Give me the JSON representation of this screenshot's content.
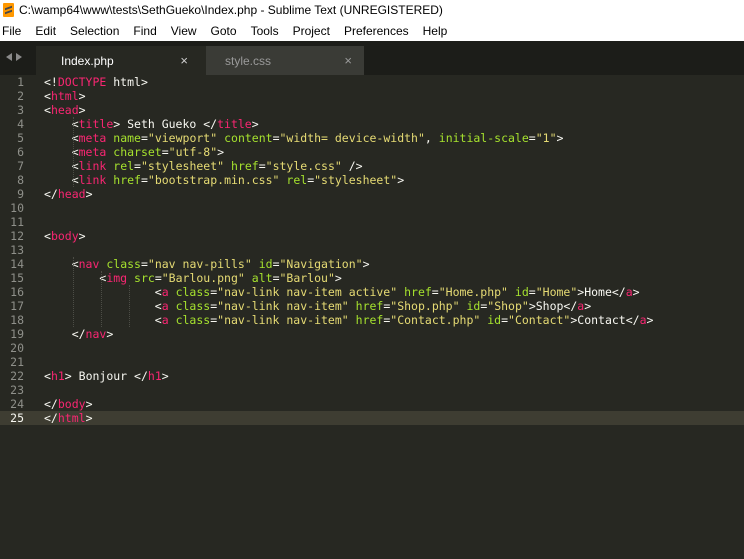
{
  "window": {
    "title": "C:\\wamp64\\www\\tests\\SethGueko\\Index.php - Sublime Text (UNREGISTERED)"
  },
  "menu": [
    "File",
    "Edit",
    "Selection",
    "Find",
    "View",
    "Goto",
    "Tools",
    "Project",
    "Preferences",
    "Help"
  ],
  "tabs": [
    {
      "label": "Index.php",
      "active": true,
      "close": "×"
    },
    {
      "label": "style.css",
      "active": false,
      "close": "×"
    }
  ],
  "current_line": 25,
  "colors": {
    "background": "#272822",
    "tag": "#f92672",
    "attribute": "#a6e22e",
    "string": "#e6db74",
    "text": "#f8f8f2",
    "line_number": "#8f908a"
  },
  "code_lines": [
    [
      [
        "p",
        "<!"
      ],
      [
        "t",
        "DOCTYPE"
      ],
      [
        "p",
        " html>"
      ]
    ],
    [
      [
        "p",
        "<"
      ],
      [
        "t",
        "html"
      ],
      [
        "p",
        ">"
      ]
    ],
    [
      [
        "p",
        "<"
      ],
      [
        "t",
        "head"
      ],
      [
        "p",
        ">"
      ]
    ],
    [
      [
        "p",
        "    <"
      ],
      [
        "t",
        "title"
      ],
      [
        "p",
        "> Seth Gueko </"
      ],
      [
        "t",
        "title"
      ],
      [
        "p",
        ">"
      ]
    ],
    [
      [
        "p",
        "    <"
      ],
      [
        "t",
        "meta"
      ],
      [
        "p",
        " "
      ],
      [
        "a",
        "name"
      ],
      [
        "p",
        "="
      ],
      [
        "s",
        "\"viewport\""
      ],
      [
        "p",
        " "
      ],
      [
        "a",
        "content"
      ],
      [
        "p",
        "="
      ],
      [
        "s",
        "\"width= device-width\""
      ],
      [
        "p",
        ", "
      ],
      [
        "a",
        "initial-scale"
      ],
      [
        "p",
        "="
      ],
      [
        "s",
        "\"1\""
      ],
      [
        "p",
        ">"
      ]
    ],
    [
      [
        "p",
        "    <"
      ],
      [
        "t",
        "meta"
      ],
      [
        "p",
        " "
      ],
      [
        "a",
        "charset"
      ],
      [
        "p",
        "="
      ],
      [
        "s",
        "\"utf-8\""
      ],
      [
        "p",
        ">"
      ]
    ],
    [
      [
        "p",
        "    <"
      ],
      [
        "t",
        "link"
      ],
      [
        "p",
        " "
      ],
      [
        "a",
        "rel"
      ],
      [
        "p",
        "="
      ],
      [
        "s",
        "\"stylesheet\""
      ],
      [
        "p",
        " "
      ],
      [
        "a",
        "href"
      ],
      [
        "p",
        "="
      ],
      [
        "s",
        "\"style.css\""
      ],
      [
        "p",
        " />"
      ]
    ],
    [
      [
        "p",
        "    <"
      ],
      [
        "t",
        "link"
      ],
      [
        "p",
        " "
      ],
      [
        "a",
        "href"
      ],
      [
        "p",
        "="
      ],
      [
        "s",
        "\"bootstrap.min.css\""
      ],
      [
        "p",
        " "
      ],
      [
        "a",
        "rel"
      ],
      [
        "p",
        "="
      ],
      [
        "s",
        "\"stylesheet\""
      ],
      [
        "p",
        ">"
      ]
    ],
    [
      [
        "p",
        "</"
      ],
      [
        "t",
        "head"
      ],
      [
        "p",
        ">"
      ]
    ],
    [],
    [],
    [
      [
        "p",
        "<"
      ],
      [
        "t",
        "body"
      ],
      [
        "p",
        ">"
      ]
    ],
    [],
    [
      [
        "p",
        "    <"
      ],
      [
        "t",
        "nav"
      ],
      [
        "p",
        " "
      ],
      [
        "a",
        "class"
      ],
      [
        "p",
        "="
      ],
      [
        "s",
        "\"nav nav-pills\""
      ],
      [
        "p",
        " "
      ],
      [
        "a",
        "id"
      ],
      [
        "p",
        "="
      ],
      [
        "s",
        "\"Navigation\""
      ],
      [
        "p",
        ">"
      ]
    ],
    [
      [
        "p",
        "        <"
      ],
      [
        "t",
        "img"
      ],
      [
        "p",
        " "
      ],
      [
        "a",
        "src"
      ],
      [
        "p",
        "="
      ],
      [
        "s",
        "\"Barlou.png\""
      ],
      [
        "p",
        " "
      ],
      [
        "a",
        "alt"
      ],
      [
        "p",
        "="
      ],
      [
        "s",
        "\"Barlou\""
      ],
      [
        "p",
        ">"
      ]
    ],
    [
      [
        "p",
        "                <"
      ],
      [
        "t",
        "a"
      ],
      [
        "p",
        " "
      ],
      [
        "a",
        "class"
      ],
      [
        "p",
        "="
      ],
      [
        "s",
        "\"nav-link nav-item active\""
      ],
      [
        "p",
        " "
      ],
      [
        "a",
        "href"
      ],
      [
        "p",
        "="
      ],
      [
        "s",
        "\"Home.php\""
      ],
      [
        "p",
        " "
      ],
      [
        "a",
        "id"
      ],
      [
        "p",
        "="
      ],
      [
        "s",
        "\"Home\""
      ],
      [
        "p",
        ">Home</"
      ],
      [
        "t",
        "a"
      ],
      [
        "p",
        ">"
      ]
    ],
    [
      [
        "p",
        "                <"
      ],
      [
        "t",
        "a"
      ],
      [
        "p",
        " "
      ],
      [
        "a",
        "class"
      ],
      [
        "p",
        "="
      ],
      [
        "s",
        "\"nav-link nav-item\""
      ],
      [
        "p",
        " "
      ],
      [
        "a",
        "href"
      ],
      [
        "p",
        "="
      ],
      [
        "s",
        "\"Shop.php\""
      ],
      [
        "p",
        " "
      ],
      [
        "a",
        "id"
      ],
      [
        "p",
        "="
      ],
      [
        "s",
        "\"Shop\""
      ],
      [
        "p",
        ">Shop</"
      ],
      [
        "t",
        "a"
      ],
      [
        "p",
        ">"
      ]
    ],
    [
      [
        "p",
        "                <"
      ],
      [
        "t",
        "a"
      ],
      [
        "p",
        " "
      ],
      [
        "a",
        "class"
      ],
      [
        "p",
        "="
      ],
      [
        "s",
        "\"nav-link nav-item\""
      ],
      [
        "p",
        " "
      ],
      [
        "a",
        "href"
      ],
      [
        "p",
        "="
      ],
      [
        "s",
        "\"Contact.php\""
      ],
      [
        "p",
        " "
      ],
      [
        "a",
        "id"
      ],
      [
        "p",
        "="
      ],
      [
        "s",
        "\"Contact\""
      ],
      [
        "p",
        ">Contact</"
      ],
      [
        "t",
        "a"
      ],
      [
        "p",
        ">"
      ]
    ],
    [
      [
        "p",
        "    </"
      ],
      [
        "t",
        "nav"
      ],
      [
        "p",
        ">"
      ]
    ],
    [],
    [],
    [
      [
        "p",
        "<"
      ],
      [
        "t",
        "h1"
      ],
      [
        "p",
        "> Bonjour </"
      ],
      [
        "t",
        "h1"
      ],
      [
        "p",
        ">"
      ]
    ],
    [],
    [
      [
        "p",
        "</"
      ],
      [
        "t",
        "body"
      ],
      [
        "p",
        ">"
      ]
    ],
    [
      [
        "p",
        "</"
      ],
      [
        "t",
        "html"
      ],
      [
        "p",
        ">"
      ]
    ]
  ]
}
